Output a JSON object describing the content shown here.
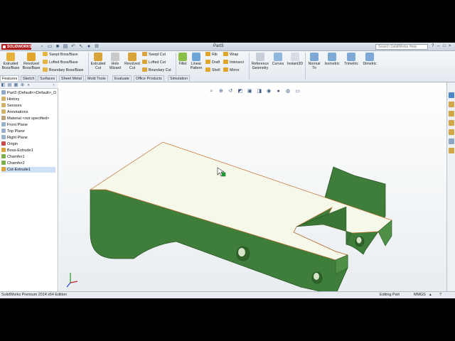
{
  "app": {
    "logo_text": "SOLIDWORKS",
    "doc_title": "Part3",
    "search_placeholder": "Search SolidWorks Help"
  },
  "ribbon": {
    "extruded_boss": "Extruded Boss/Base",
    "revolved_boss": "Revolved Boss/Base",
    "swept_boss": "Swept Boss/Base",
    "lofted_boss": "Lofted Boss/Base",
    "boundary_boss": "Boundary Boss/Base",
    "extruded_cut": "Extruded Cut",
    "hole_wizard": "Hole Wizard",
    "revolved_cut": "Revolved Cut",
    "swept_cut": "Swept Cut",
    "lofted_cut": "Lofted Cut",
    "boundary_cut": "Boundary Cut",
    "fillet": "Fillet",
    "linear_pattern": "Linear Pattern",
    "rib": "Rib",
    "draft": "Draft",
    "shell": "Shell",
    "wrap": "Wrap",
    "intersect": "Intersect",
    "mirror": "Mirror",
    "reference_geometry": "Reference Geometry",
    "curves": "Curves",
    "instant3d": "Instant3D",
    "normal_to": "Normal To",
    "isometric": "Isometric",
    "trimetric": "Trimetric",
    "dimetric": "Dimetric"
  },
  "tabs": [
    "Features",
    "Sketch",
    "Surfaces",
    "Sheet Metal",
    "Mold Tools",
    "Evaluate",
    "Office Products",
    "Simulation"
  ],
  "tree": {
    "root": "Part3  (Default<<Default>_D",
    "items": [
      "History",
      "Sensors",
      "Annotations",
      "Material <not specified>",
      "Front Plane",
      "Top Plane",
      "Right Plane",
      "Origin",
      "Boss-Extrude1",
      "Chamfer1",
      "Chamfer2",
      "Cut-Extrude1"
    ]
  },
  "status": {
    "edition": "SolidWorks Premium 2014 x64 Edition",
    "mode": "Editing Part",
    "units": "MMGS"
  },
  "colors": {
    "model_face_top": "#f7fbe8",
    "model_green": "#3f7d3a",
    "model_green_dark": "#2e6229",
    "accent": "#b21d1d"
  }
}
